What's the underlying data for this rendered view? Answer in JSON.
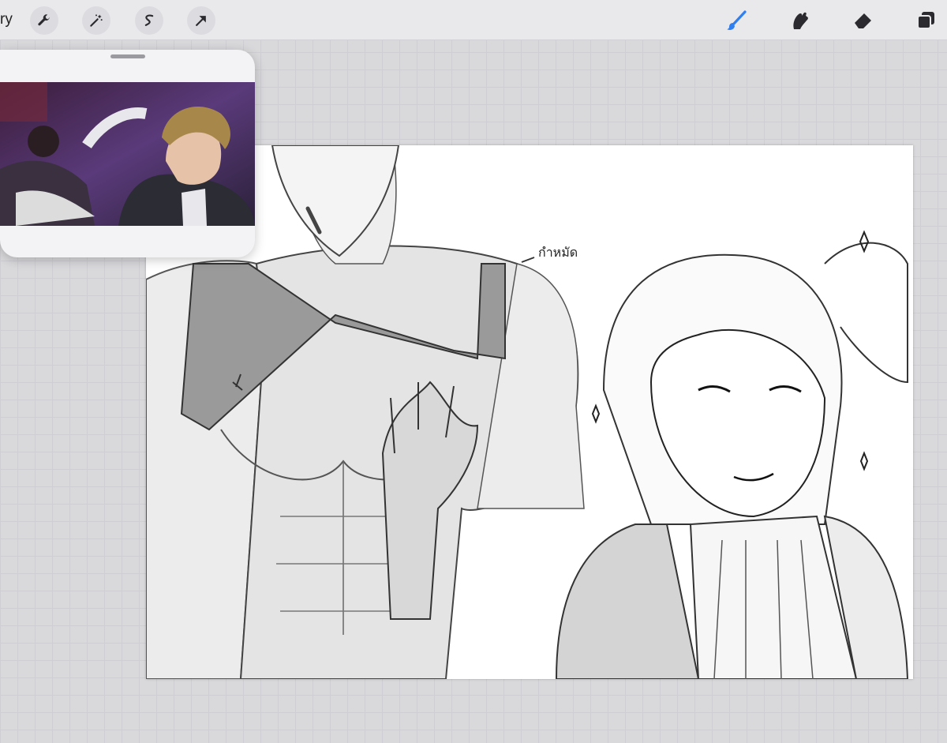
{
  "toolbar": {
    "gallery_label": "ry",
    "left_tools": [
      {
        "name": "actions",
        "icon": "wrench-icon"
      },
      {
        "name": "adjustments",
        "icon": "magic-wand-icon"
      },
      {
        "name": "selection",
        "icon": "selection-s-icon"
      },
      {
        "name": "transform",
        "icon": "arrow-cursor-icon"
      }
    ],
    "right_tools": [
      {
        "name": "brush",
        "icon": "brush-icon",
        "active": true,
        "color": "#2f7ff0"
      },
      {
        "name": "smudge",
        "icon": "smudge-icon",
        "active": false
      },
      {
        "name": "eraser",
        "icon": "eraser-icon",
        "active": false
      },
      {
        "name": "layers",
        "icon": "layers-icon",
        "active": false
      }
    ]
  },
  "reference_window": {
    "handle": "drag-handle"
  },
  "canvas": {
    "annotation_text": "กำหมัด",
    "background": "#ffffff"
  },
  "colors": {
    "toolbar_bg": "#e9e9ec",
    "workspace_bg": "#d9d9dc",
    "accent": "#2f7ff0"
  }
}
